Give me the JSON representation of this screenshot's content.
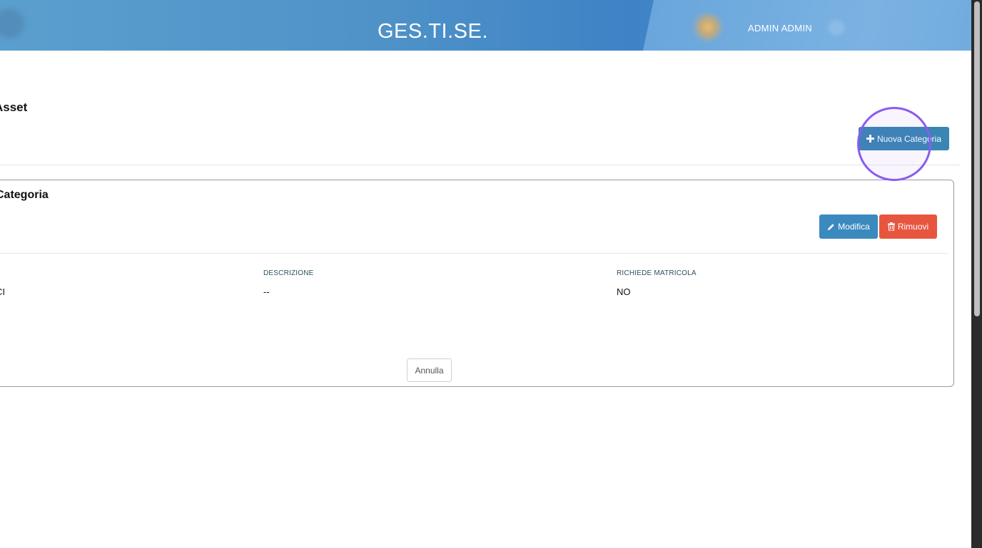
{
  "header": {
    "app_title": "GES.TI.SE.",
    "user_name": "ADMIN ADMIN"
  },
  "page": {
    "title": "Asset",
    "new_category_button": "Nuova Categoria"
  },
  "card": {
    "title": "Categoria",
    "edit_button": "Modifica",
    "remove_button": "Rimuovi",
    "fields": [
      {
        "label": "",
        "value": "CI"
      },
      {
        "label": "DESCRIZIONE",
        "value": "--"
      },
      {
        "label": "RICHIEDE MATRICOLA",
        "value": "NO"
      }
    ],
    "cancel_button": "Annulla"
  },
  "colors": {
    "primary": "#3a85b4",
    "danger": "#e8553f",
    "highlight": "#8a5cf0"
  }
}
